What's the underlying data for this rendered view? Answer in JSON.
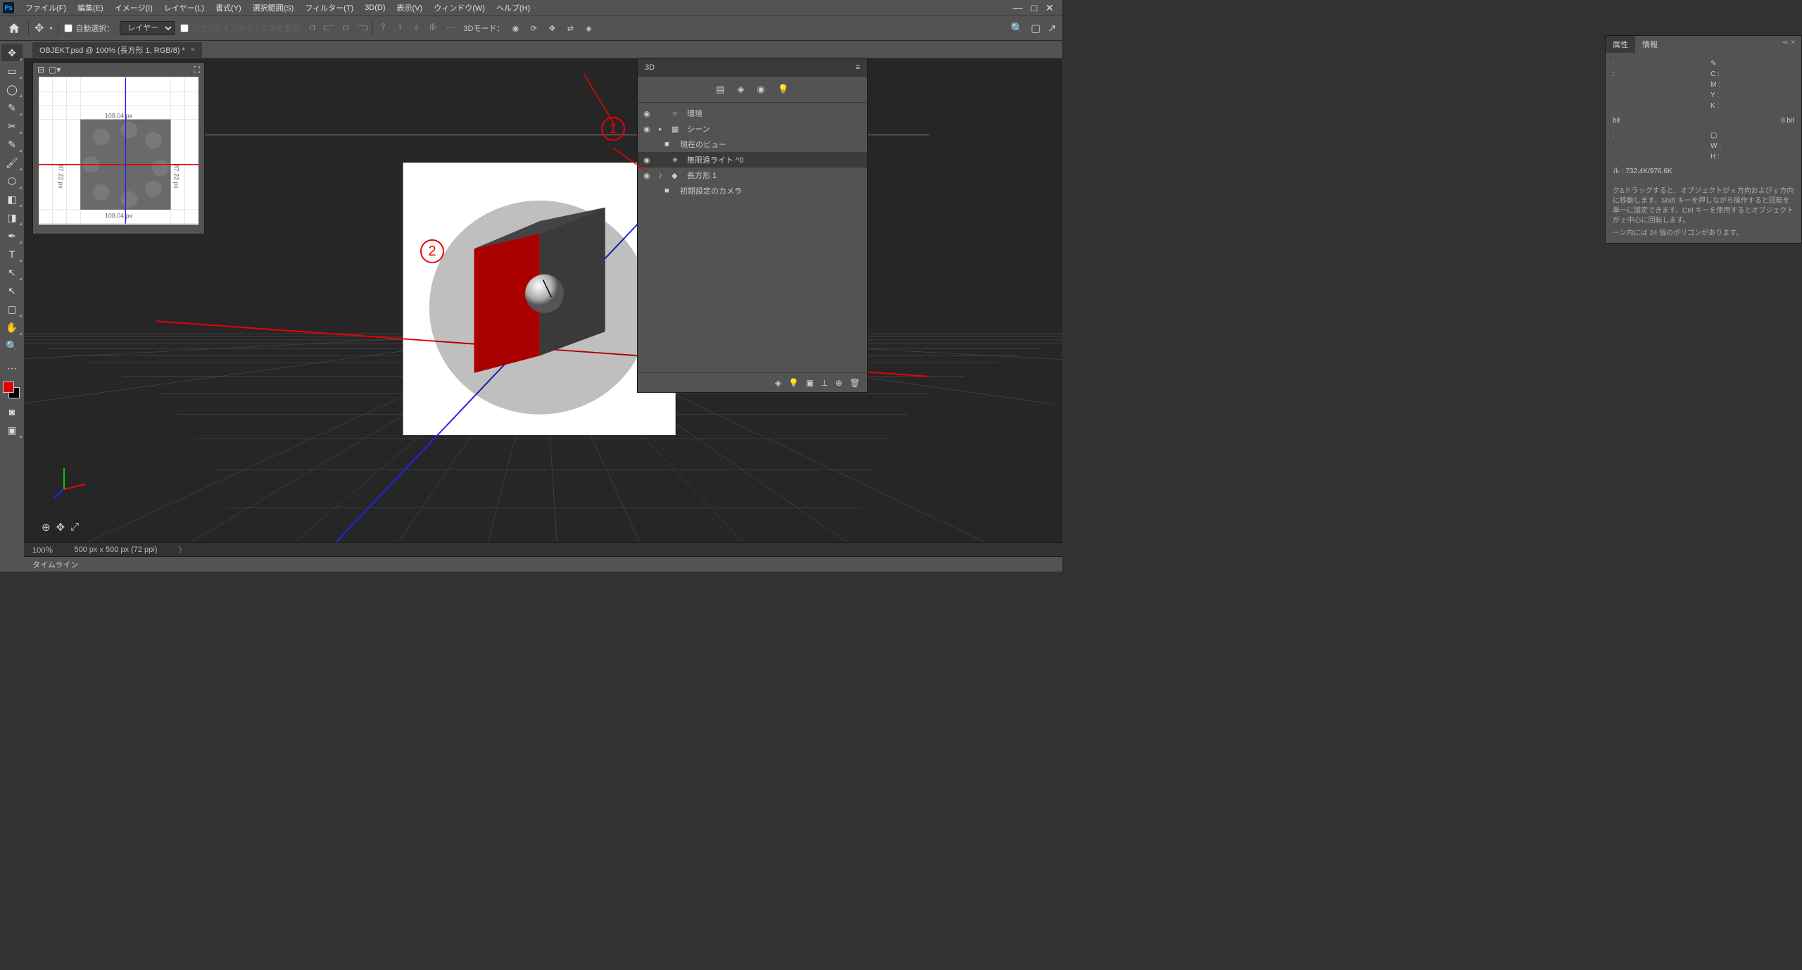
{
  "menubar": {
    "items": [
      "ファイル(F)",
      "編集(E)",
      "イメージ(I)",
      "レイヤー(L)",
      "書式(Y)",
      "選択範囲(S)",
      "フィルター(T)",
      "3D(D)",
      "表示(V)",
      "ウィンドウ(W)",
      "ヘルプ(H)"
    ]
  },
  "options": {
    "auto_select": "自動選択：",
    "layer_select": "レイヤー",
    "bbox_text": "バウンディングボックスを表示",
    "mode3d_label": "3Dモード："
  },
  "document": {
    "tab_title": "OBJEKT.psd @ 100% (長方形 1, RGB/8) *",
    "zoom": "100％",
    "dimensions": "500 px x 500 px (72 ppi)"
  },
  "timeline": {
    "label": "タイムライン"
  },
  "navigator": {
    "dim_x": "108.04  px",
    "dim_y": "87.22  px"
  },
  "panel3d": {
    "title": "3D",
    "items": [
      {
        "eye": "◉",
        "arrow": "",
        "icon": "☼",
        "label": "環境",
        "indent": 0
      },
      {
        "eye": "◉",
        "arrow": "▸",
        "icon": "▦",
        "label": "シーン",
        "indent": 0
      },
      {
        "eye": "",
        "arrow": "",
        "icon": "■",
        "label": "現在のビュー",
        "indent": 1
      },
      {
        "eye": "◉",
        "arrow": "",
        "icon": "☀",
        "label": "無限遠ライト  ^0",
        "indent": 0,
        "selected": true
      },
      {
        "eye": "◉",
        "arrow": "〉",
        "icon": "◆",
        "label": "長方形 1",
        "indent": 0
      },
      {
        "eye": "",
        "arrow": "",
        "icon": "■",
        "label": "初期設定のカメラ",
        "indent": 1
      }
    ]
  },
  "info": {
    "tabs": [
      "属性",
      "情報"
    ],
    "cmyk": {
      "c": "C :",
      "m": "M :",
      "y": "Y :",
      "k": "K :"
    },
    "bit": "bit",
    "bit2": "8 bit",
    "wh": {
      "w": "W :",
      "h": "H :"
    },
    "filesize_label": "ル :",
    "filesize": "732.4K/976.6K",
    "help1": "ク&ドラッグすると、オブジェクトが x 方向および y 方向に移動します。Shift キーを押しながら操作すると回転を単一に固定できます。Ctrl キーを使用するとオブジェクトが z 中心に回転します。",
    "help2": "ーン内には 24 個のポリゴンがあります。"
  },
  "callouts": {
    "one": "1",
    "two": "2"
  }
}
